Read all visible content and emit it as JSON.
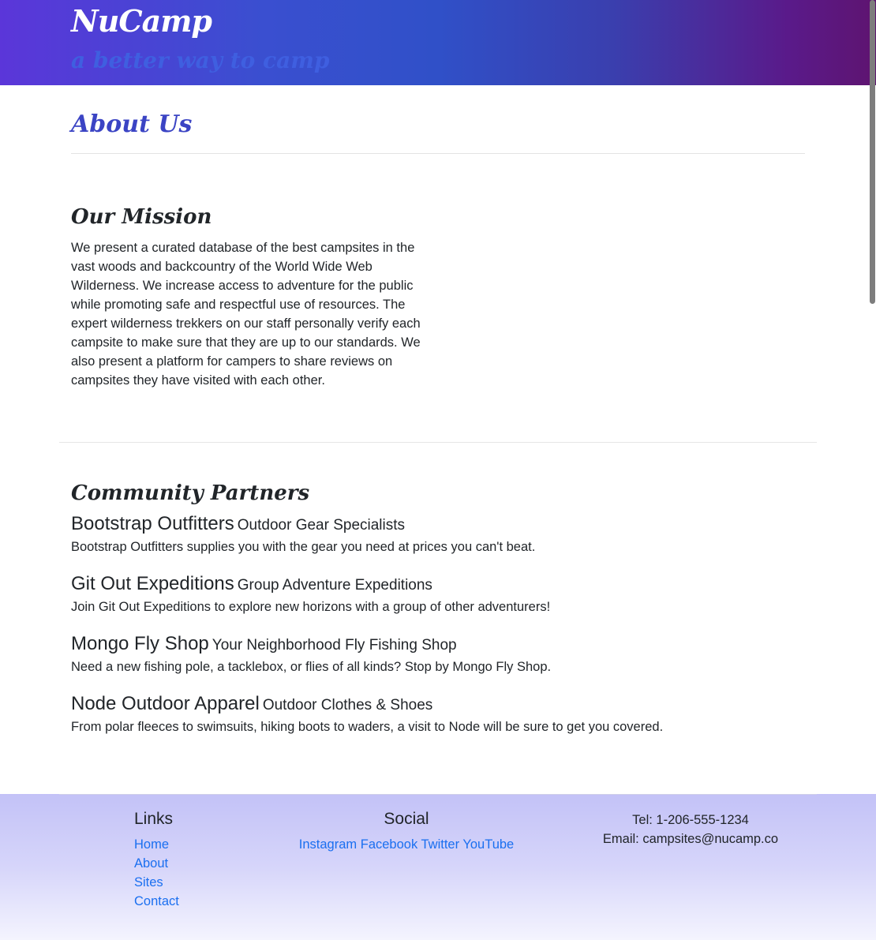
{
  "header": {
    "brand": "NuCamp",
    "tagline": "a better way to camp"
  },
  "page": {
    "title": "About Us"
  },
  "mission": {
    "heading": "Our Mission",
    "text": "We present a curated database of the best campsites in the vast woods and backcountry of the World Wide Web Wilderness. We increase access to adventure for the public while promoting safe and respectful use of resources. The expert wilderness trekkers on our staff personally verify each campsite to make sure that they are up to our standards. We also present a platform for campers to share reviews on campsites they have visited with each other."
  },
  "partners": {
    "heading": "Community Partners",
    "items": [
      {
        "name": "Bootstrap Outfitters",
        "tag": "Outdoor Gear Specialists",
        "desc": "Bootstrap Outfitters supplies you with the gear you need at prices you can't beat."
      },
      {
        "name": "Git Out Expeditions",
        "tag": "Group Adventure Expeditions",
        "desc": "Join Git Out Expeditions to explore new horizons with a group of other adventurers!"
      },
      {
        "name": "Mongo Fly Shop",
        "tag": "Your Neighborhood Fly Fishing Shop",
        "desc": "Need a new fishing pole, a tacklebox, or flies of all kinds? Stop by Mongo Fly Shop."
      },
      {
        "name": "Node Outdoor Apparel",
        "tag": "Outdoor Clothes & Shoes",
        "desc": "From polar fleeces to swimsuits, hiking boots to waders, a visit to Node will be sure to get you covered."
      }
    ]
  },
  "footer": {
    "links_heading": "Links",
    "links": [
      "Home",
      "About",
      "Sites",
      "Contact"
    ],
    "social_heading": "Social",
    "social": [
      "Instagram",
      "Facebook",
      "Twitter",
      "YouTube"
    ],
    "tel": "Tel: 1-206-555-1234",
    "email": "Email: campsites@nucamp.co"
  },
  "colors": {
    "link": "#1a6ff0",
    "title": "#3b44c4"
  }
}
